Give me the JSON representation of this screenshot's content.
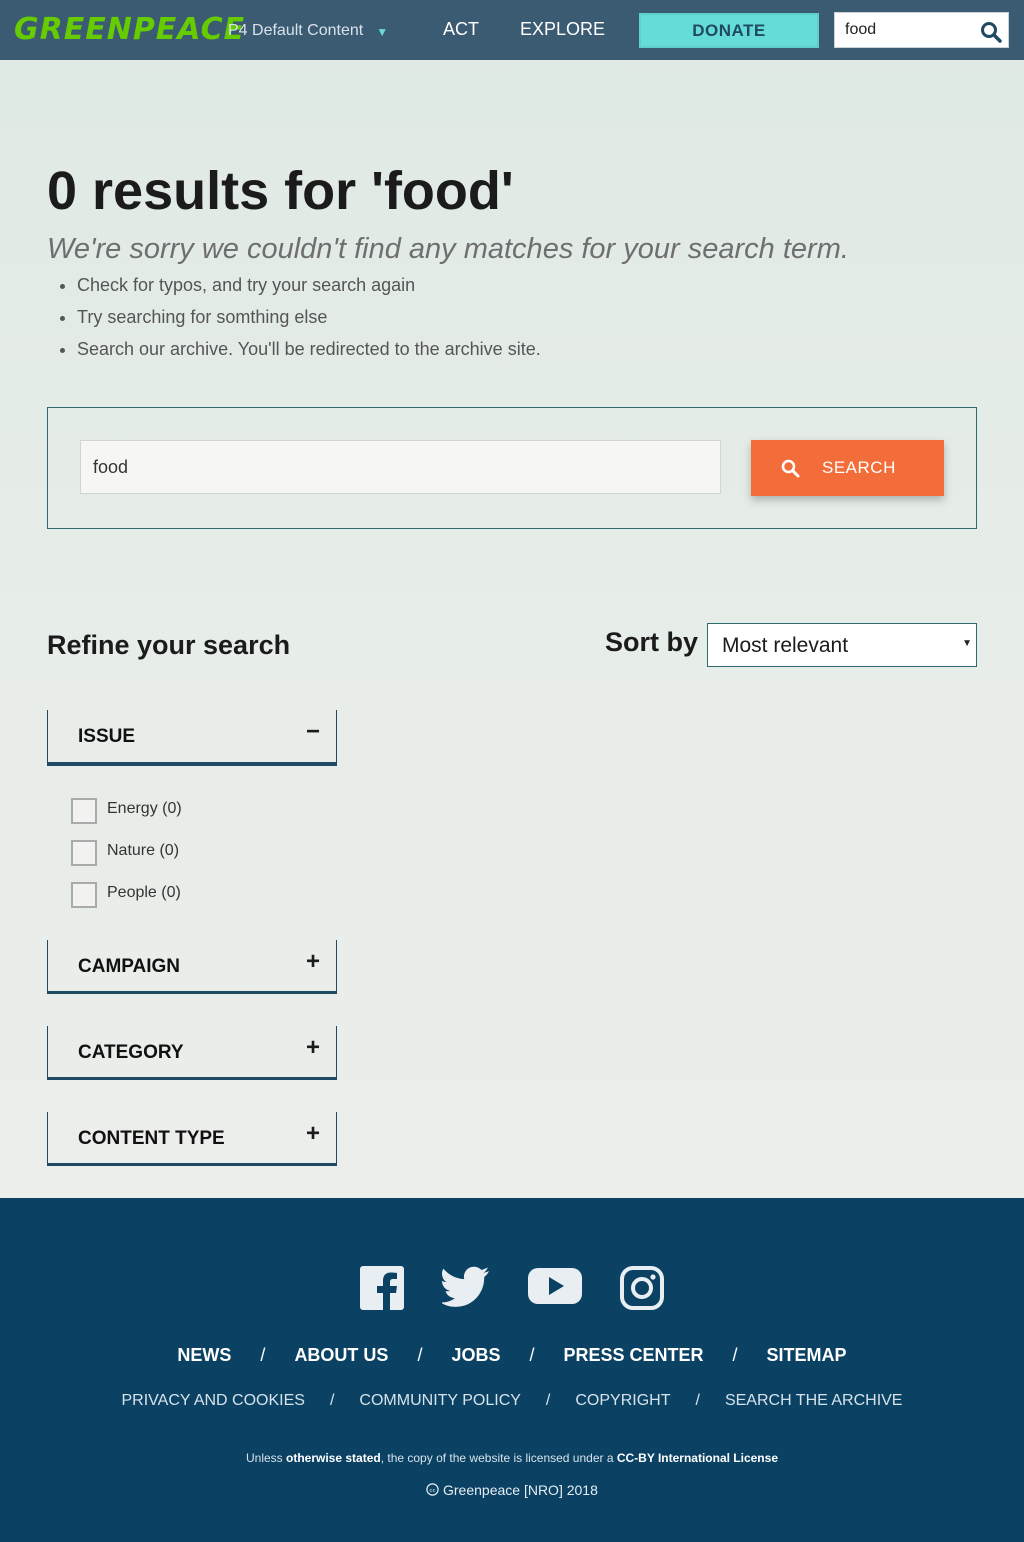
{
  "header": {
    "logo_text": "GREENPEACE",
    "site_selector": "P4 Default Content",
    "nav": {
      "act": "ACT",
      "explore": "EXPLORE"
    },
    "donate_label": "DONATE",
    "search_value": "food"
  },
  "results": {
    "title": "0 results for 'food'",
    "sorry": "We're sorry we couldn't find any matches for your search term.",
    "tips": [
      "Check for typos, and try your search again",
      "Try searching for somthing else",
      "Search our archive. You'll be redirected to the archive site."
    ]
  },
  "search_form": {
    "value": "food",
    "button_label": "SEARCH"
  },
  "refine": {
    "title": "Refine your search",
    "sort_label": "Sort by",
    "sort_value": "Most relevant",
    "filters": [
      {
        "title": "ISSUE",
        "state_icon": "minus-icon",
        "options": [
          {
            "label": "Energy (0)"
          },
          {
            "label": "Nature (0)"
          },
          {
            "label": "People (0)"
          }
        ]
      },
      {
        "title": "CAMPAIGN",
        "state_icon": "plus-icon"
      },
      {
        "title": "CATEGORY",
        "state_icon": "plus-icon"
      },
      {
        "title": "CONTENT TYPE",
        "state_icon": "plus-icon"
      }
    ]
  },
  "footer": {
    "social_icons": [
      "facebook-icon",
      "twitter-icon",
      "youtube-icon",
      "instagram-icon"
    ],
    "primary_links": [
      "NEWS",
      "ABOUT US",
      "JOBS",
      "PRESS CENTER",
      "SITEMAP"
    ],
    "secondary_links": [
      "PRIVACY AND COOKIES",
      "COMMUNITY POLICY",
      "COPYRIGHT",
      "SEARCH THE ARCHIVE"
    ],
    "license_prefix": "Unless ",
    "license_link1": "otherwise stated",
    "license_middle": ", the copy of the website is licensed under a ",
    "license_link2": "CC-BY International License",
    "copyright": "Greenpeace [NRO] 2018"
  },
  "colors": {
    "header_bg": "#3b5b72",
    "logo_green": "#66cc00",
    "donate_bg": "#66dcd8",
    "search_button": "#f36d3a",
    "footer_bg": "#0b4264",
    "filter_border": "#1f4a62"
  }
}
